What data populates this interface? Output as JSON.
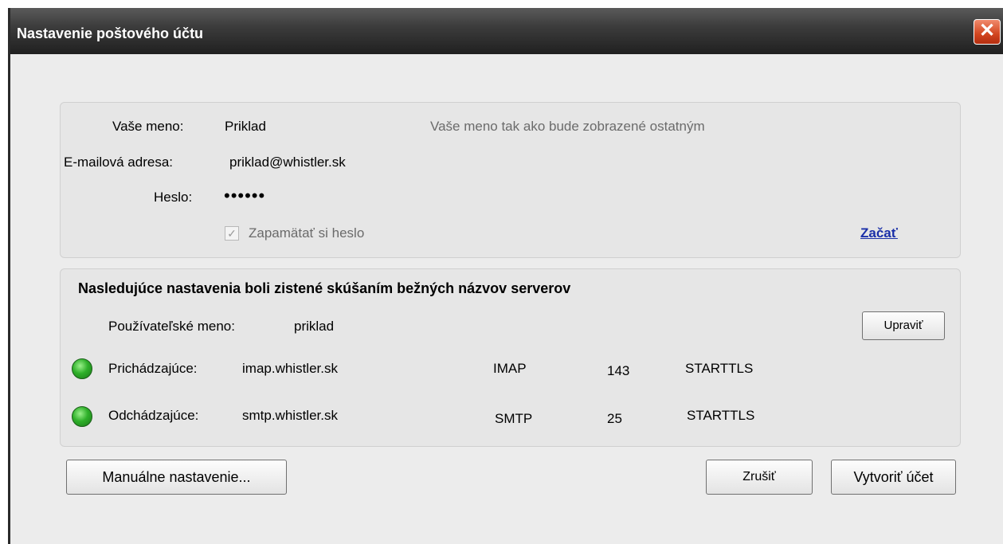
{
  "window": {
    "title": "Nastavenie poštového účtu"
  },
  "form": {
    "name_label": "Vaše meno:",
    "name_value": "Priklad",
    "name_hint": "Vaše meno tak ako bude zobrazené ostatným",
    "email_label": "E-mailová adresa:",
    "email_value": "priklad@whistler.sk",
    "password_label": "Heslo:",
    "password_value": "••••••",
    "remember_label": "Zapamätať si heslo",
    "remember_checked": true,
    "start_link": "Začať"
  },
  "detected": {
    "heading": "Nasledujúce nastavenia boli zistené skúšaním bežných názvov serverov",
    "username_label": "Používateľské meno:",
    "username_value": "priklad",
    "edit_button": "Upraviť",
    "servers": [
      {
        "label": "Prichádzajúce:",
        "host": "imap.whistler.sk",
        "protocol": "IMAP",
        "port": "143",
        "security": "STARTTLS",
        "status_color": "#2fb02a"
      },
      {
        "label": "Odchádzajúce:",
        "host": "smtp.whistler.sk",
        "protocol": "SMTP",
        "port": "25",
        "security": "STARTTLS",
        "status_color": "#2fb02a"
      }
    ]
  },
  "buttons": {
    "manual": "Manuálne nastavenie...",
    "cancel": "Zrušiť",
    "create": "Vytvoriť účet"
  },
  "icons": {
    "close": "close-icon",
    "status": "status-ok-icon",
    "check": "checkmark-icon"
  }
}
